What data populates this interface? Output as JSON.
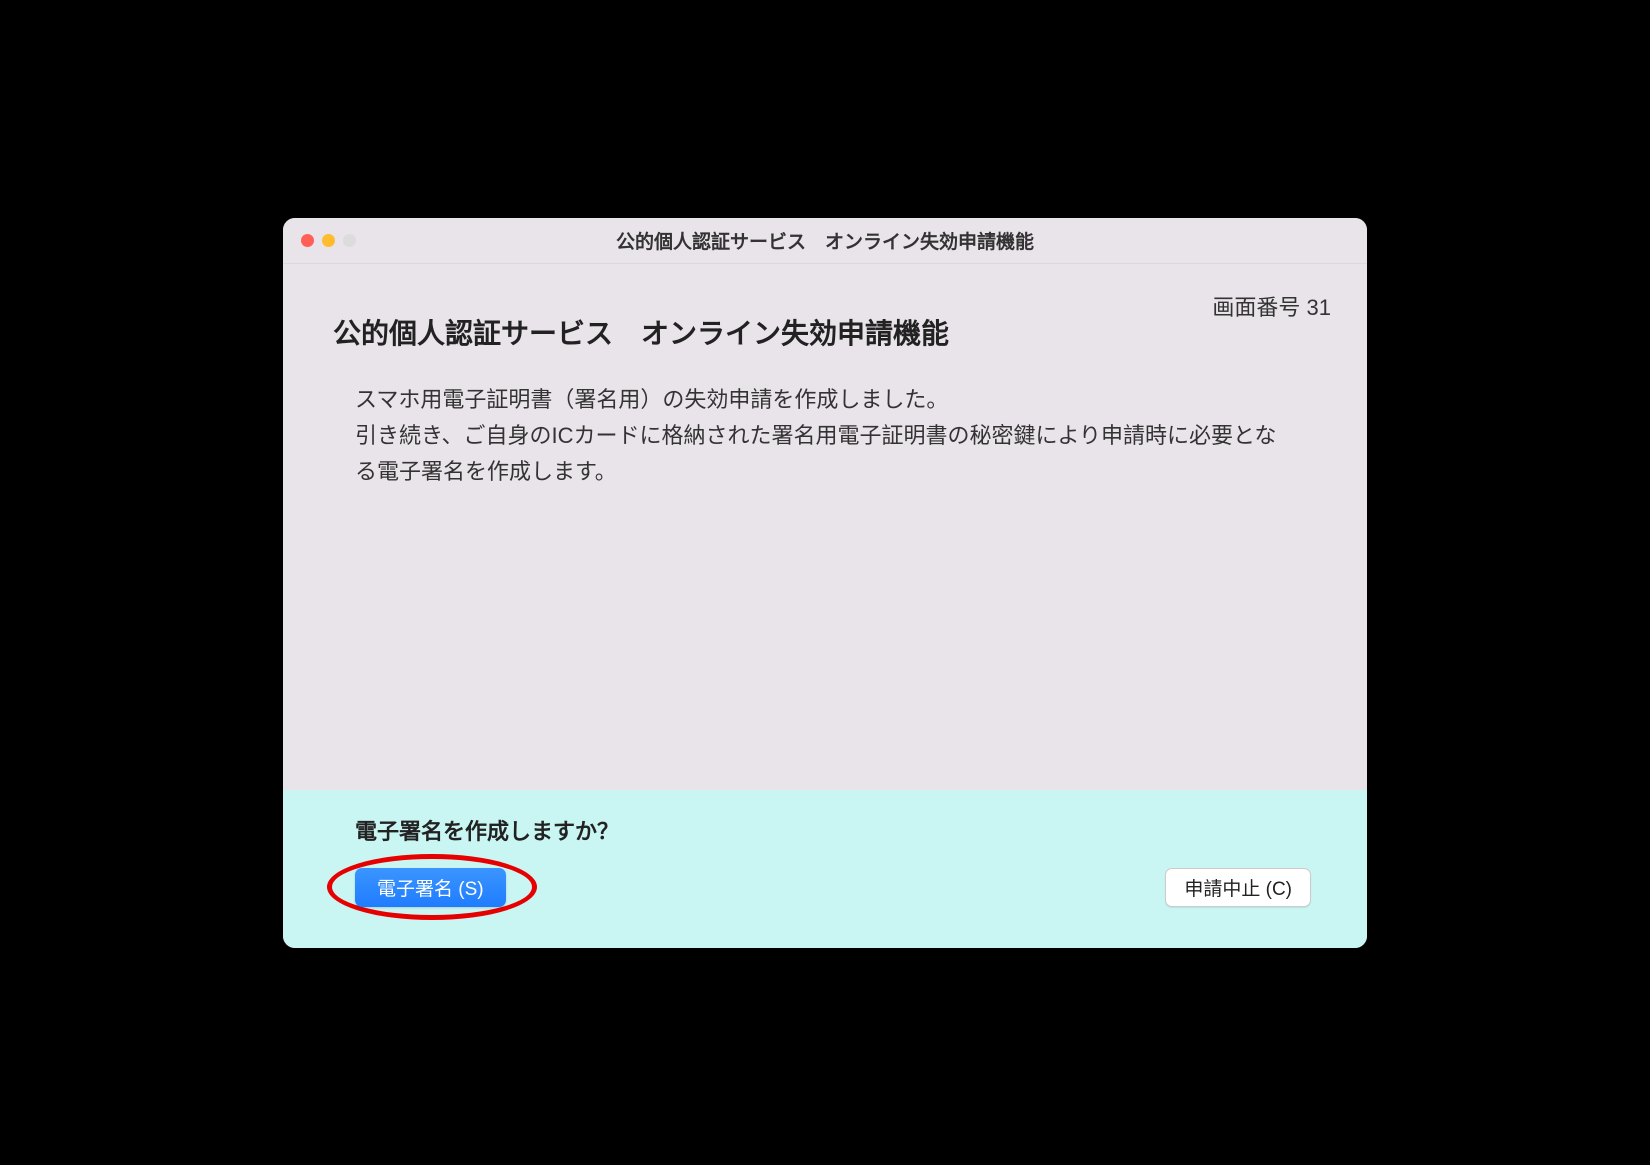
{
  "window": {
    "title": "公的個人認証サービス　オンライン失効申請機能"
  },
  "screen": {
    "label": "画面番号 31",
    "heading": "公的個人認証サービス　オンライン失効申請機能",
    "body_line1": "スマホ用電子証明書（署名用）の失効申請を作成しました。",
    "body_line2": "引き続き、ご自身のICカードに格納された署名用電子証明書の秘密鍵により申請時に必要となる電子署名を作成します。"
  },
  "footer": {
    "prompt": "電子署名を作成しますか？",
    "primary_button": "電子署名 (S)",
    "secondary_button": "申請中止 (C)"
  }
}
